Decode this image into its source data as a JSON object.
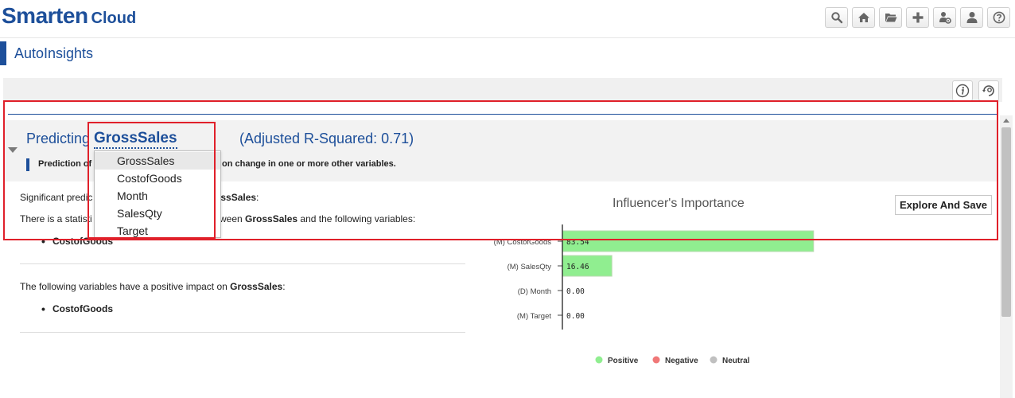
{
  "brand": {
    "name": "Smarten",
    "sub": "Cloud"
  },
  "toolbar": {
    "buttons": [
      {
        "icon": "search-icon"
      },
      {
        "icon": "home-icon"
      },
      {
        "icon": "folder-open-icon"
      },
      {
        "icon": "plus-icon"
      },
      {
        "icon": "user-settings-icon"
      },
      {
        "icon": "user-icon"
      },
      {
        "icon": "help-icon"
      }
    ]
  },
  "page": {
    "title": "AutoInsights"
  },
  "prediction": {
    "label": "Predicting",
    "variable": "GrossSales",
    "adjusted": "(Adjusted R-Squared: 0.71)",
    "description_left": "Prediction of",
    "description_right": "on change in one or more other variables."
  },
  "dropdown": {
    "options": [
      "GrossSales",
      "CostofGoods",
      "Month",
      "SalesQty",
      "Target"
    ],
    "selected": "GrossSales"
  },
  "insights": {
    "significant_left": "Significant predic",
    "significant_right_prefix": "oss",
    "significant_right_bold": "Sales",
    "significant_right_suffix": ":",
    "stat_left": "There is a statisti",
    "stat_mid": "etween ",
    "stat_var": "GrossSales",
    "stat_end": " and the following variables:",
    "significant_vars": [
      "CostofGoods"
    ],
    "positive_prefix": "The following variables have a positive impact on ",
    "positive_var": "GrossSales",
    "positive_suffix": ":",
    "positive_vars": [
      "CostofGoods"
    ]
  },
  "explore_button": "Explore And Save",
  "colors": {
    "brand": "#1d4f9a",
    "positive": "#90ee90",
    "negative": "#f07878",
    "neutral": "#c0c0c0",
    "highlight": "#e0202a"
  },
  "chart_data": {
    "type": "bar",
    "orientation": "horizontal",
    "title": "Influencer's Importance",
    "categories": [
      "(M) CostofGoods",
      "(M) SalesQty",
      "(D) Month",
      "(M) Target"
    ],
    "values": [
      83.54,
      16.46,
      0.0,
      0.0
    ],
    "labels": [
      "83.54",
      "16.46",
      "0.00",
      "0.00"
    ],
    "impact": [
      "Positive",
      "Positive",
      "Neutral",
      "Neutral"
    ],
    "xlim": [
      0,
      100
    ],
    "legend": [
      {
        "name": "Positive",
        "color": "#90ee90"
      },
      {
        "name": "Negative",
        "color": "#f07878"
      },
      {
        "name": "Neutral",
        "color": "#c0c0c0"
      }
    ],
    "legend_position": "bottom"
  }
}
